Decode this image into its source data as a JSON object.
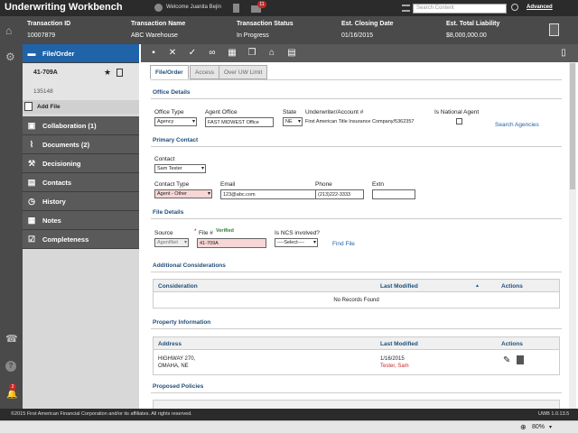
{
  "app": {
    "title": "Underwriting Workbench",
    "welcome": "Welcome Juanita Bejin",
    "mail_count": "11",
    "search_placeholder": "Search Content",
    "advanced": "Advanced"
  },
  "transaction": {
    "headers": [
      "Transaction ID",
      "Transaction Name",
      "Transaction Status",
      "Est. Closing Date",
      "Est. Total Liability"
    ],
    "values": [
      "10007879",
      "ABC Warehouse",
      "In Progress",
      "01/16/2015",
      "$8,000,000.00"
    ]
  },
  "sidebar": {
    "file_order": "File/Order",
    "file_id": "41-709A",
    "file_sub": "135148",
    "add_file": "Add File",
    "items": [
      {
        "label": "Collaboration (1)",
        "icon": "collaboration-icon"
      },
      {
        "label": "Documents (2)",
        "icon": "paperclip-icon"
      },
      {
        "label": "Decisioning",
        "icon": "gavel-icon"
      },
      {
        "label": "Contacts",
        "icon": "contacts-icon"
      },
      {
        "label": "History",
        "icon": "clock-icon"
      },
      {
        "label": "Notes",
        "icon": "notes-icon"
      },
      {
        "label": "Completeness",
        "icon": "checklist-icon"
      }
    ],
    "notification_count": "2"
  },
  "tabs": [
    "File/Order",
    "Access",
    "Over UW Limit"
  ],
  "office": {
    "heading": "Office Details",
    "office_type_label": "Office Type",
    "office_type_value": "Agency",
    "agent_office_label": "Agent Office",
    "agent_office_value": "FAST MIDWEST Office",
    "state_label": "State",
    "state_value": "NE",
    "underwriter_label": "Underwriter/Account #",
    "underwriter_value": "First American Title Insurance Company/5362357",
    "national_label": "Is National Agent",
    "search_agencies": "Search Agencies"
  },
  "contact": {
    "heading": "Primary Contact",
    "contact_label": "Contact",
    "contact_value": "Sam Tester",
    "type_label": "Contact Type",
    "type_value": "Agent - Other",
    "email_label": "Email",
    "email_value": "123@abc.com",
    "phone_label": "Phone",
    "phone_value": "(213)222-3333",
    "extn_label": "Extn"
  },
  "file": {
    "heading": "File Details",
    "source_label": "Source",
    "source_value": "AgentNet",
    "file_label": "File #",
    "verified": "Verified",
    "file_value": "41-709A",
    "ncs_label": "Is NCS involved?",
    "ncs_value": "----Select----",
    "find_file": "Find File"
  },
  "considerations": {
    "heading": "Additional Considerations",
    "columns": [
      "Consideration",
      "Last Modified",
      "Actions"
    ],
    "empty": "No Records Found"
  },
  "property": {
    "heading": "Property Information",
    "columns": [
      "Address",
      "Last Modified",
      "Actions"
    ],
    "address_line1": "HIGHWAY 270,",
    "address_line2": "OMAHA, NE",
    "modified_date": "1/16/2015",
    "modified_by": "Tester, Sam"
  },
  "policies": {
    "heading": "Proposed Policies"
  },
  "footer": {
    "copyright": "©2015 First American Financial Corporation and/or its affiliates. All rights reserved.",
    "version": "UWB 1.0.13.5"
  },
  "status": {
    "zoom": "80%"
  }
}
